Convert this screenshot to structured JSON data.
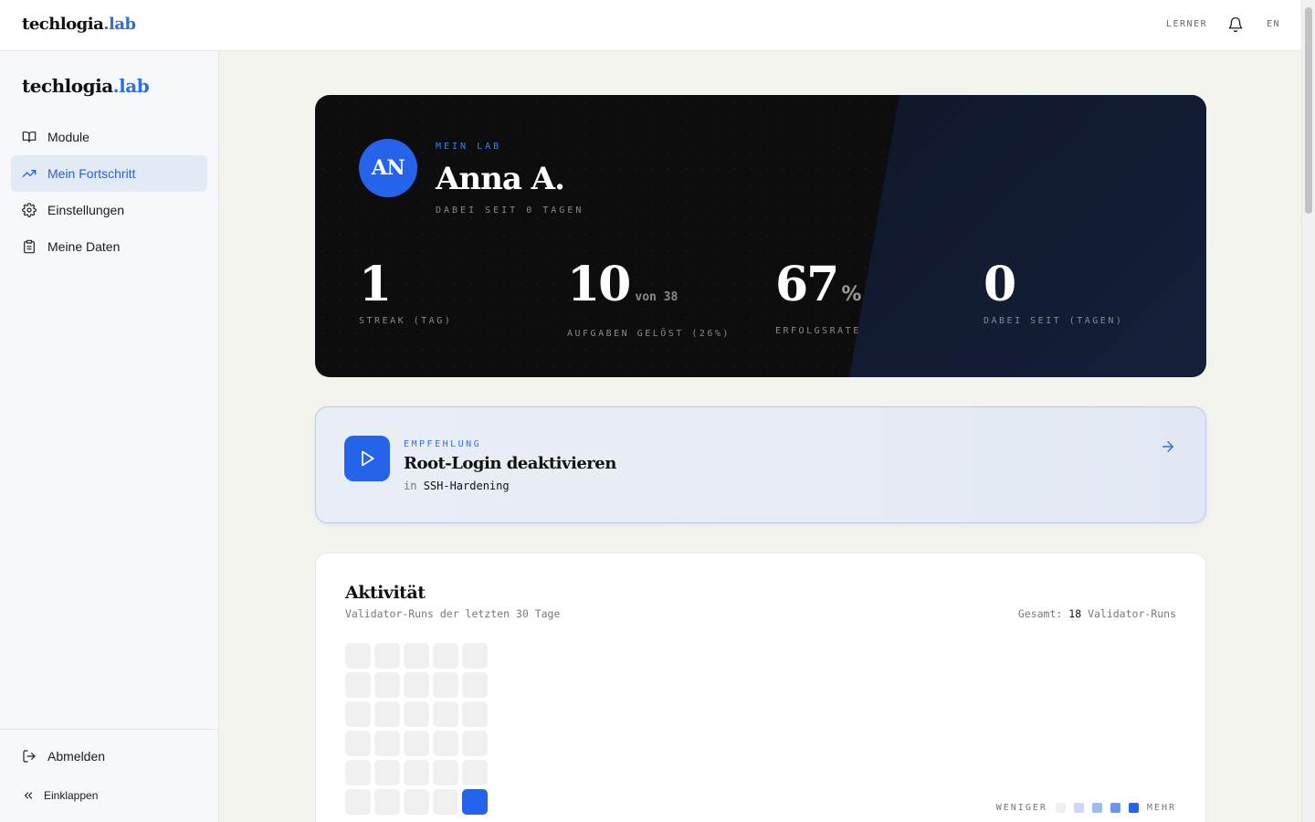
{
  "brand": {
    "name": "techlogia",
    "accent": ".lab"
  },
  "topbar": {
    "role": "LERNER",
    "lang": "EN"
  },
  "sidebar": {
    "items": [
      {
        "label": "Module",
        "icon": "book-icon"
      },
      {
        "label": "Mein Fortschritt",
        "icon": "trending-up-icon",
        "active": true
      },
      {
        "label": "Einstellungen",
        "icon": "gear-icon"
      },
      {
        "label": "Meine Daten",
        "icon": "clipboard-icon"
      }
    ],
    "logout": "Abmelden",
    "collapse": "Einklappen"
  },
  "hero": {
    "initials": "AN",
    "kicker": "MEIN LAB",
    "name": "Anna A.",
    "since": "DABEI SEIT 0 TAGEN",
    "stats": [
      {
        "value": "1",
        "suffix": "",
        "label": "STREAK (TAG)"
      },
      {
        "value": "10",
        "suffix": "von 38",
        "label": "AUFGABEN GELÖST (26%)"
      },
      {
        "value": "67",
        "suffix": "%",
        "label": "ERFOLGSRATE"
      },
      {
        "value": "0",
        "suffix": "",
        "label": "DABEI SEIT (TAGEN)"
      }
    ]
  },
  "recommendation": {
    "kicker": "EMPFEHLUNG",
    "title": "Root-Login deaktivieren",
    "in_prefix": "in",
    "module": "SSH-Hardening"
  },
  "activity": {
    "title": "Aktivität",
    "subtitle": "Validator-Runs der letzten 30 Tage",
    "total_prefix": "Gesamt:",
    "total_value": "18",
    "total_suffix": "Validator-Runs",
    "days": [
      0,
      0,
      0,
      0,
      0,
      0,
      0,
      0,
      0,
      0,
      0,
      0,
      0,
      0,
      0,
      0,
      0,
      0,
      0,
      0,
      0,
      0,
      0,
      0,
      0,
      0,
      0,
      0,
      0,
      4
    ],
    "legend_less": "WENIGER",
    "legend_more": "MEHR",
    "legend_colors": [
      "#f0f0f0",
      "#c9d8f7",
      "#9dbaf1",
      "#6a97ea",
      "#2563eb"
    ]
  },
  "colors": {
    "accent": "#2563eb",
    "hero_bg": "#0d0d0d"
  }
}
